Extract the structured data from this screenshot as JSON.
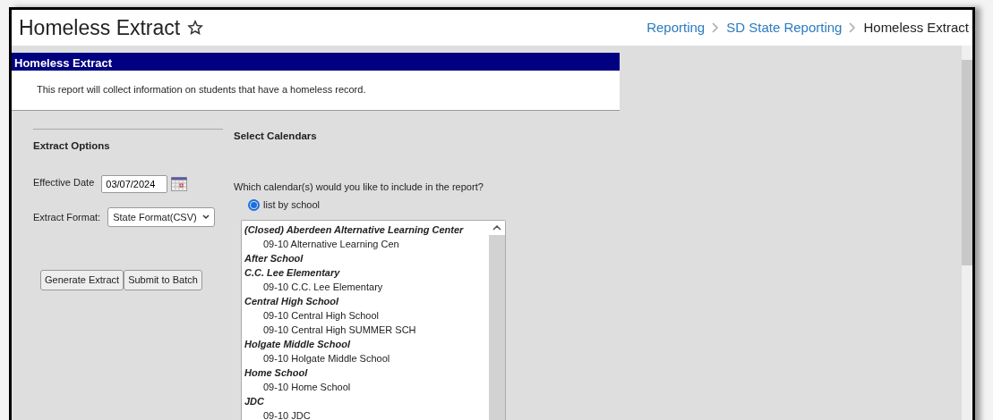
{
  "page": {
    "title": "Homeless Extract",
    "favorite": false
  },
  "breadcrumbs": [
    {
      "label": "Reporting",
      "kind": "link"
    },
    {
      "label": "SD State Reporting",
      "kind": "link"
    },
    {
      "label": "Homeless Extract",
      "kind": "current"
    }
  ],
  "panel": {
    "title": "Homeless Extract",
    "description": "This report will collect information on students that have a homeless record."
  },
  "extract_options": {
    "heading": "Extract Options",
    "effective_date": {
      "label": "Effective Date",
      "value": "03/07/2024"
    },
    "extract_format": {
      "label": "Extract Format:",
      "value": "State Format(CSV)"
    },
    "buttons": [
      "Generate Extract",
      "Submit to Batch"
    ]
  },
  "select_calendars": {
    "heading": "Select Calendars",
    "question": "Which calendar(s) would you like to include in the report?",
    "options": [
      {
        "label": "list by school",
        "selected": true
      }
    ],
    "schools": [
      {
        "name": "(Closed) Aberdeen Alternative Learning Center",
        "children": [
          {
            "name": "09-10 Alternative Learning Cen"
          }
        ]
      },
      {
        "name": "After School"
      },
      {
        "name": "C.C. Lee Elementary",
        "children": [
          {
            "name": "09-10 C.C. Lee Elementary"
          }
        ]
      },
      {
        "name": "Central High School",
        "children": [
          {
            "name": "09-10 Central High School"
          },
          {
            "name": "09-10 Central High SUMMER SCH"
          }
        ]
      },
      {
        "name": "Holgate Middle School",
        "children": [
          {
            "name": "09-10 Holgate Middle School"
          }
        ]
      },
      {
        "name": "Home School",
        "children": [
          {
            "name": "09-10 Home School"
          }
        ]
      },
      {
        "name": "JDC",
        "children": [
          {
            "name": "09-10 JDC"
          }
        ]
      }
    ]
  }
}
